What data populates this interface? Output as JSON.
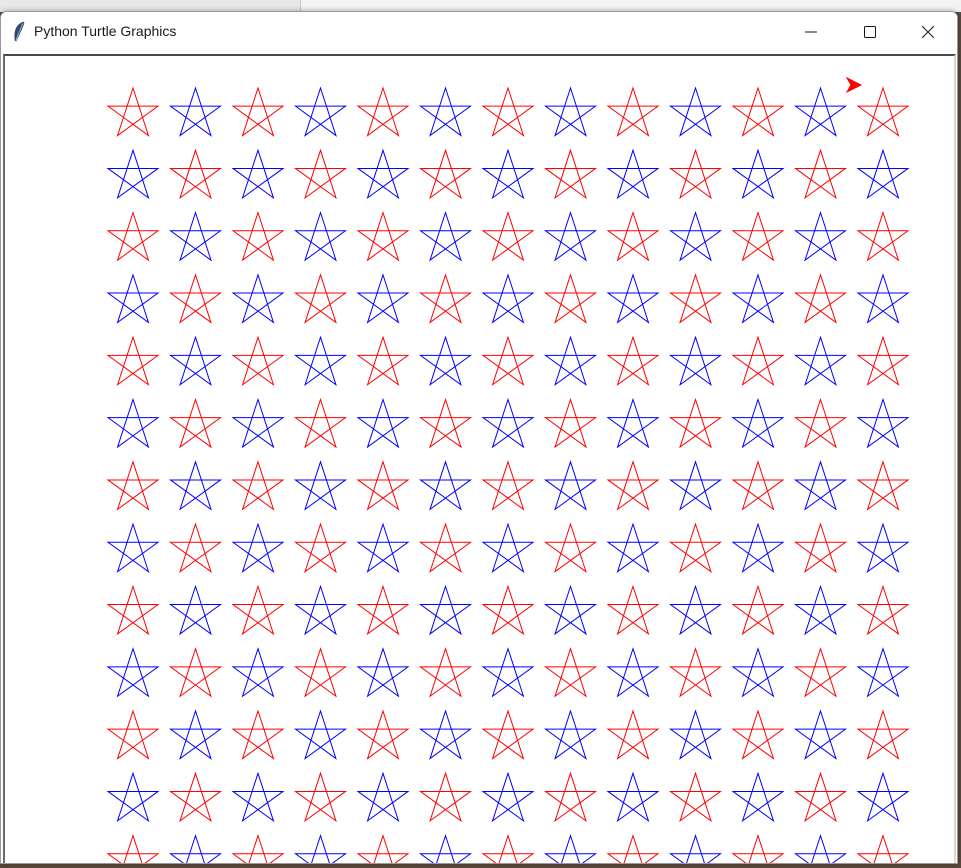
{
  "window": {
    "title": "Python Turtle Graphics",
    "controls": {
      "minimize_icon": "minimize-icon",
      "maximize_icon": "maximize-icon",
      "close_icon": "close-icon"
    }
  },
  "drawing": {
    "rows": 13,
    "columns": 13,
    "colors": [
      "#ff0000",
      "#0000ff"
    ],
    "shape": "five-point star",
    "turtle_cursor": {
      "shape": "arrow",
      "color": "#ff0000"
    }
  }
}
